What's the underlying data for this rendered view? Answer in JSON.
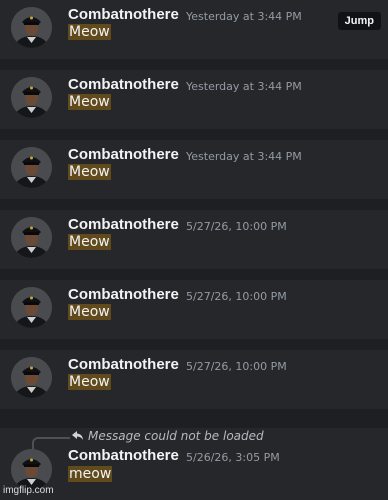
{
  "jump_label": "Jump",
  "results": [
    {
      "username": "Combatnothere",
      "timestamp": "Yesterday at 3:44 PM",
      "content": "Meow"
    },
    {
      "username": "Combatnothere",
      "timestamp": "Yesterday at 3:44 PM",
      "content": "Meow"
    },
    {
      "username": "Combatnothere",
      "timestamp": "Yesterday at 3:44 PM",
      "content": "Meow"
    },
    {
      "username": "Combatnothere",
      "timestamp": "5/27/26, 10:00 PM",
      "content": "Meow"
    },
    {
      "username": "Combatnothere",
      "timestamp": "5/27/26, 10:00 PM",
      "content": "Meow"
    },
    {
      "username": "Combatnothere",
      "timestamp": "5/27/26, 10:00 PM",
      "content": "Meow"
    },
    {
      "username": "Combatnothere",
      "timestamp": "5/26/26, 3:05 PM",
      "content": "meow",
      "reply_text": "Message could not be loaded"
    }
  ],
  "watermark": "imgflip.com",
  "colors": {
    "background": "#1e1f22",
    "card": "#26272b",
    "highlight": "#614b1c",
    "timestamp": "#949ba4",
    "jump_button": "#111214"
  }
}
